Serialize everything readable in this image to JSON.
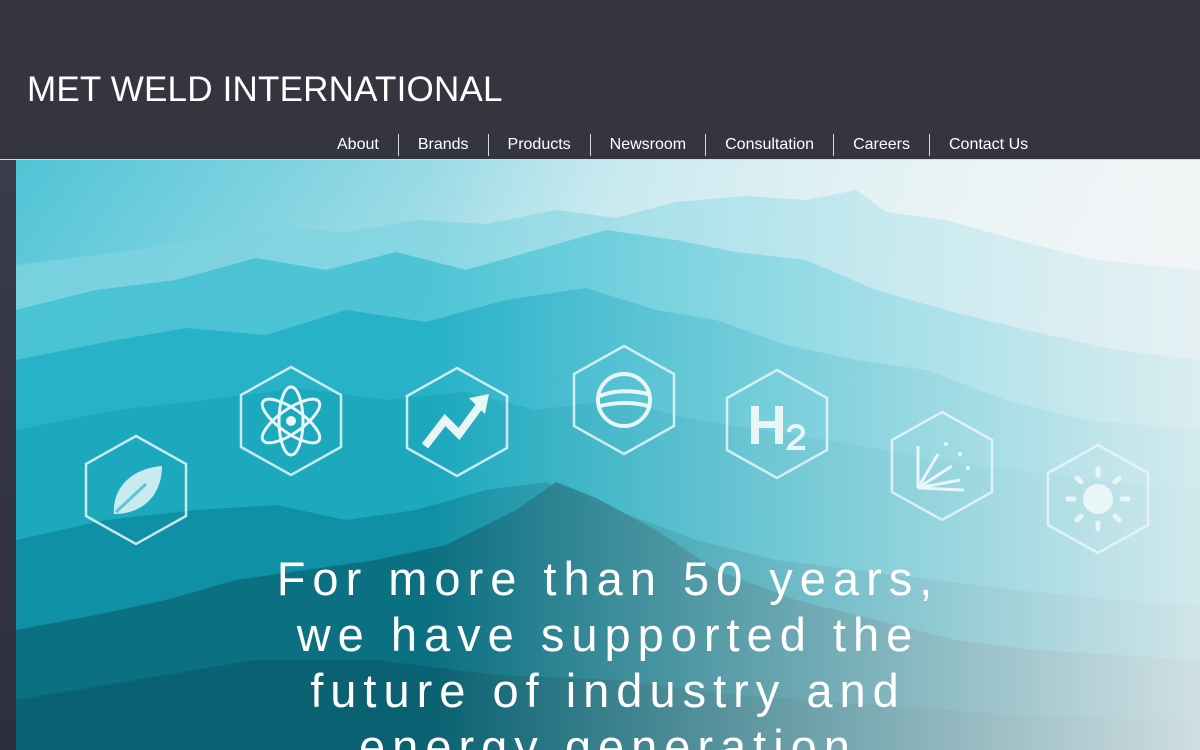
{
  "site": {
    "title": "MET WELD INTERNATIONAL"
  },
  "nav": {
    "items": [
      {
        "label": "About"
      },
      {
        "label": "Brands"
      },
      {
        "label": "Products"
      },
      {
        "label": "Newsroom"
      },
      {
        "label": "Consultation"
      },
      {
        "label": "Careers"
      },
      {
        "label": "Contact Us"
      }
    ]
  },
  "hero": {
    "headline_lines": [
      "For more than 50 years,",
      "we have supported the",
      "future of industry and",
      "energy generation"
    ],
    "icons": [
      {
        "name": "leaf-icon"
      },
      {
        "name": "atom-icon"
      },
      {
        "name": "rising-chart-icon"
      },
      {
        "name": "globe-icon"
      },
      {
        "name": "hydrogen-icon"
      },
      {
        "name": "spark-burst-icon"
      },
      {
        "name": "sun-icon"
      }
    ]
  },
  "colors": {
    "header_bg": "#34353f",
    "accent_teal": "#1fb7c9",
    "icon_stroke": "#e8f6f8"
  }
}
